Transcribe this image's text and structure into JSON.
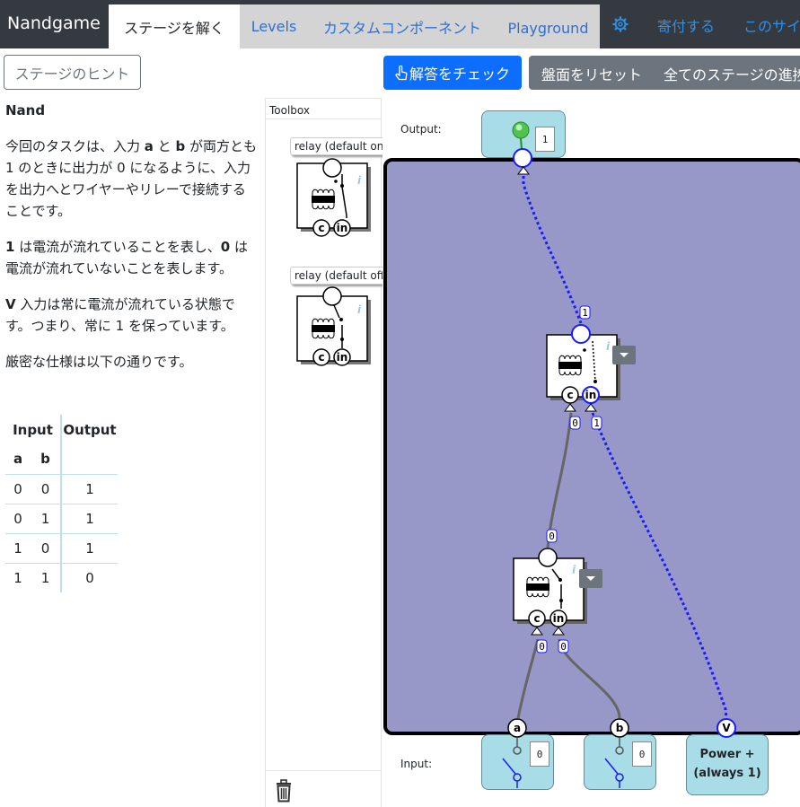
{
  "navbar": {
    "brand": "Nandgame",
    "tabs": [
      {
        "label": "ステージを解く",
        "active": true
      },
      {
        "label": "Levels",
        "active": false
      },
      {
        "label": "カスタムコンポーネント",
        "active": false
      },
      {
        "label": "Playground",
        "active": false
      }
    ],
    "settings_icon": "gear-icon",
    "donate": "寄付する",
    "about": "このサイ"
  },
  "toolbar": {
    "hint": "ステージのヒント",
    "check": "解答をチェック",
    "check_icon": "hand-pointer-icon",
    "reset": "盤面をリセット",
    "progress": "全てのステージの進捗"
  },
  "task": {
    "title": "Nand",
    "p1_pre": "今回のタスクは、入力 ",
    "p1_a": "a",
    "p1_mid": " と ",
    "p1_b": "b",
    "p1_post": " が両方とも 1 のときに出力が 0 になるように、入力を出力へとワイヤーやリレーで接続することです。",
    "p2_one": "1",
    "p2_mid": " は電流が流れていることを表し、",
    "p2_zero": "0",
    "p2_post": " は電流が流れていないことを表します。",
    "p3_v": "V",
    "p3_post": " 入力は常に電流が流れている状態です。つまり、常に 1 を保っています。",
    "p4": "厳密な仕様は以下の通りです。"
  },
  "truth_table": {
    "input_header": "Input",
    "output_header": "Output",
    "col_a": "a",
    "col_b": "b",
    "rows": [
      [
        "0",
        "0",
        "1"
      ],
      [
        "0",
        "1",
        "1"
      ],
      [
        "1",
        "0",
        "1"
      ],
      [
        "1",
        "1",
        "0"
      ]
    ]
  },
  "toolbox": {
    "title": "Toolbox",
    "relay_on": "relay (default on)",
    "relay_off": "relay (default off)",
    "pin_c": "c",
    "pin_in": "in",
    "info": "i",
    "trash_icon": "trash-icon"
  },
  "circuit": {
    "output_label": "Output:",
    "output_value": "1",
    "input_label": "Input:",
    "input_a_value": "0",
    "input_b_value": "0",
    "pin_a": "a",
    "pin_b": "b",
    "pin_v": "V",
    "power_line1": "Power +",
    "power_line2": "(always 1)",
    "pin_c": "c",
    "pin_in": "in",
    "info": "i",
    "wire_out": "1",
    "wire_top_c": "0",
    "wire_top_in": "1",
    "wire_mid": "0",
    "wire_bot_c": "0",
    "wire_bot_in": "0"
  }
}
